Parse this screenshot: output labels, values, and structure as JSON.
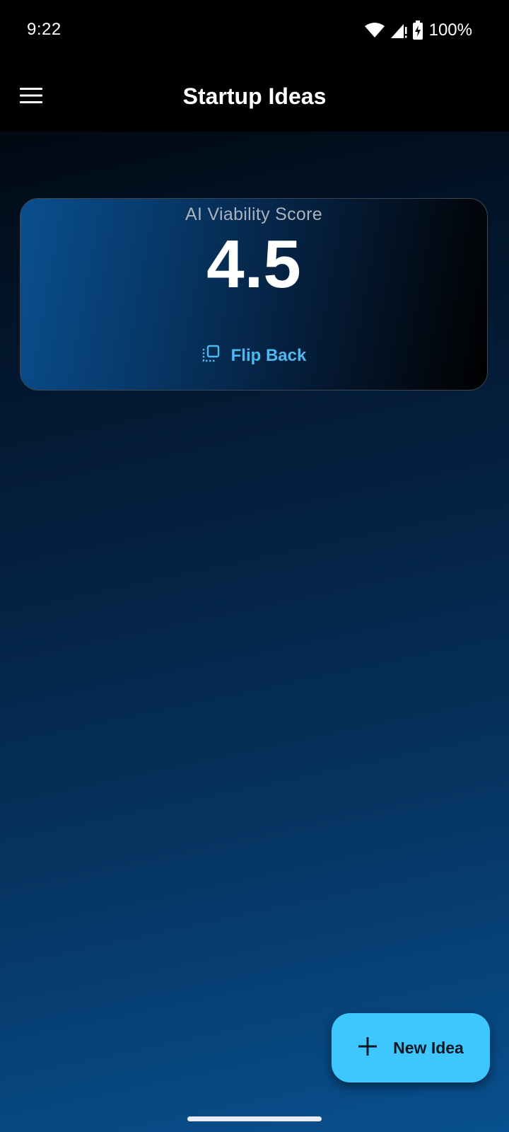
{
  "status_bar": {
    "time": "9:22",
    "battery_percent": "100%",
    "icons": [
      "wifi-icon",
      "signal-icon",
      "battery-charging-icon"
    ]
  },
  "app_bar": {
    "title": "Startup Ideas",
    "menu_icon": "hamburger-menu-icon"
  },
  "score_card": {
    "label": "AI Viability Score",
    "value": "4.5",
    "flip_back_label": "Flip Back",
    "flip_icon": "flip-icon"
  },
  "fab": {
    "label": "New Idea",
    "icon": "plus-icon",
    "color": "#3ec6ff"
  },
  "colors": {
    "accent": "#4fb8ee",
    "app_bar_bg": "#000000",
    "background_bottom": "#08508f"
  }
}
